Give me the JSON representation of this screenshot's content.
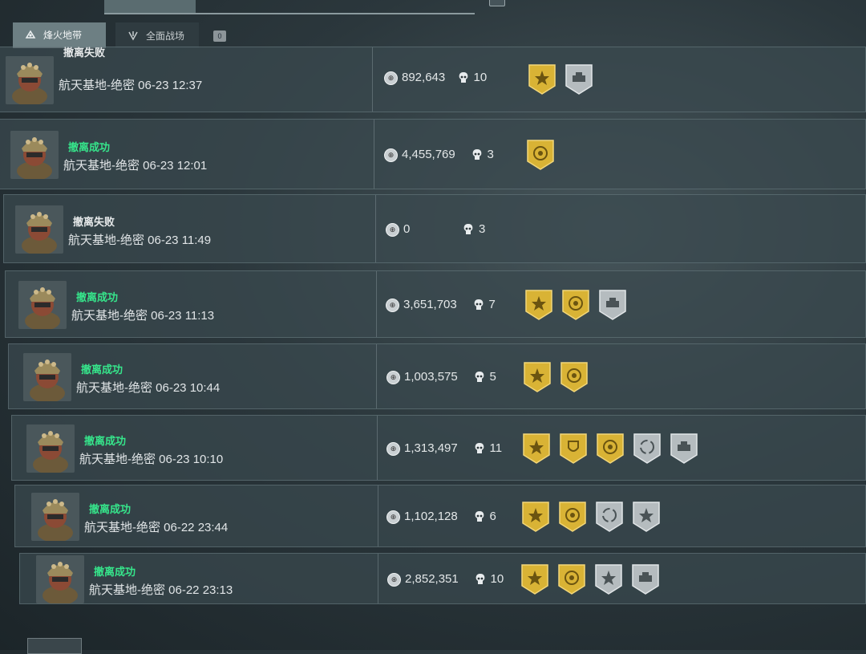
{
  "top_tabs": [
    "",
    "",
    "",
    "",
    ""
  ],
  "modes": [
    {
      "label": "烽火地带",
      "active": true,
      "icon": "fire-zone-icon"
    },
    {
      "label": "全面战场",
      "active": false,
      "icon": "battlefield-icon"
    }
  ],
  "mode_badge": "0",
  "colors": {
    "success": "#36e58b",
    "gold": "#d9b335",
    "silver": "#b5bcbf"
  },
  "records": [
    {
      "status": "撤离失败",
      "success": false,
      "location": "航天基地-绝密",
      "time": "06-23 12:37",
      "value": "892,643",
      "kills": "10",
      "medals": [
        "gold-star",
        "silver-vehicle"
      ]
    },
    {
      "status": "撤离成功",
      "success": true,
      "location": "航天基地-绝密",
      "time": "06-23 12:01",
      "value": "4,455,769",
      "kills": "3",
      "medals": [
        "gold-target"
      ]
    },
    {
      "status": "撤离失败",
      "success": false,
      "location": "航天基地-绝密",
      "time": "06-23 11:49",
      "value": "0",
      "kills": "3",
      "medals": []
    },
    {
      "status": "撤离成功",
      "success": true,
      "location": "航天基地-绝密",
      "time": "06-23 11:13",
      "value": "3,651,703",
      "kills": "7",
      "medals": [
        "gold-star",
        "gold-target",
        "silver-vehicle"
      ]
    },
    {
      "status": "撤离成功",
      "success": true,
      "location": "航天基地-绝密",
      "time": "06-23 10:44",
      "value": "1,003,575",
      "kills": "5",
      "medals": [
        "gold-star",
        "gold-target"
      ]
    },
    {
      "status": "撤离成功",
      "success": true,
      "location": "航天基地-绝密",
      "time": "06-23 10:10",
      "value": "1,313,497",
      "kills": "11",
      "medals": [
        "gold-star",
        "gold-shield",
        "gold-target",
        "silver-cycle",
        "silver-vehicle"
      ]
    },
    {
      "status": "撤离成功",
      "success": true,
      "location": "航天基地-绝密",
      "time": "06-22 23:44",
      "value": "1,102,128",
      "kills": "6",
      "medals": [
        "gold-star",
        "gold-target",
        "silver-cycle",
        "silver-star"
      ]
    },
    {
      "status": "撤离成功",
      "success": true,
      "location": "航天基地-绝密",
      "time": "06-22 23:13",
      "value": "2,852,351",
      "kills": "10",
      "medals": [
        "gold-star",
        "gold-target",
        "silver-star",
        "silver-vehicle"
      ]
    }
  ]
}
